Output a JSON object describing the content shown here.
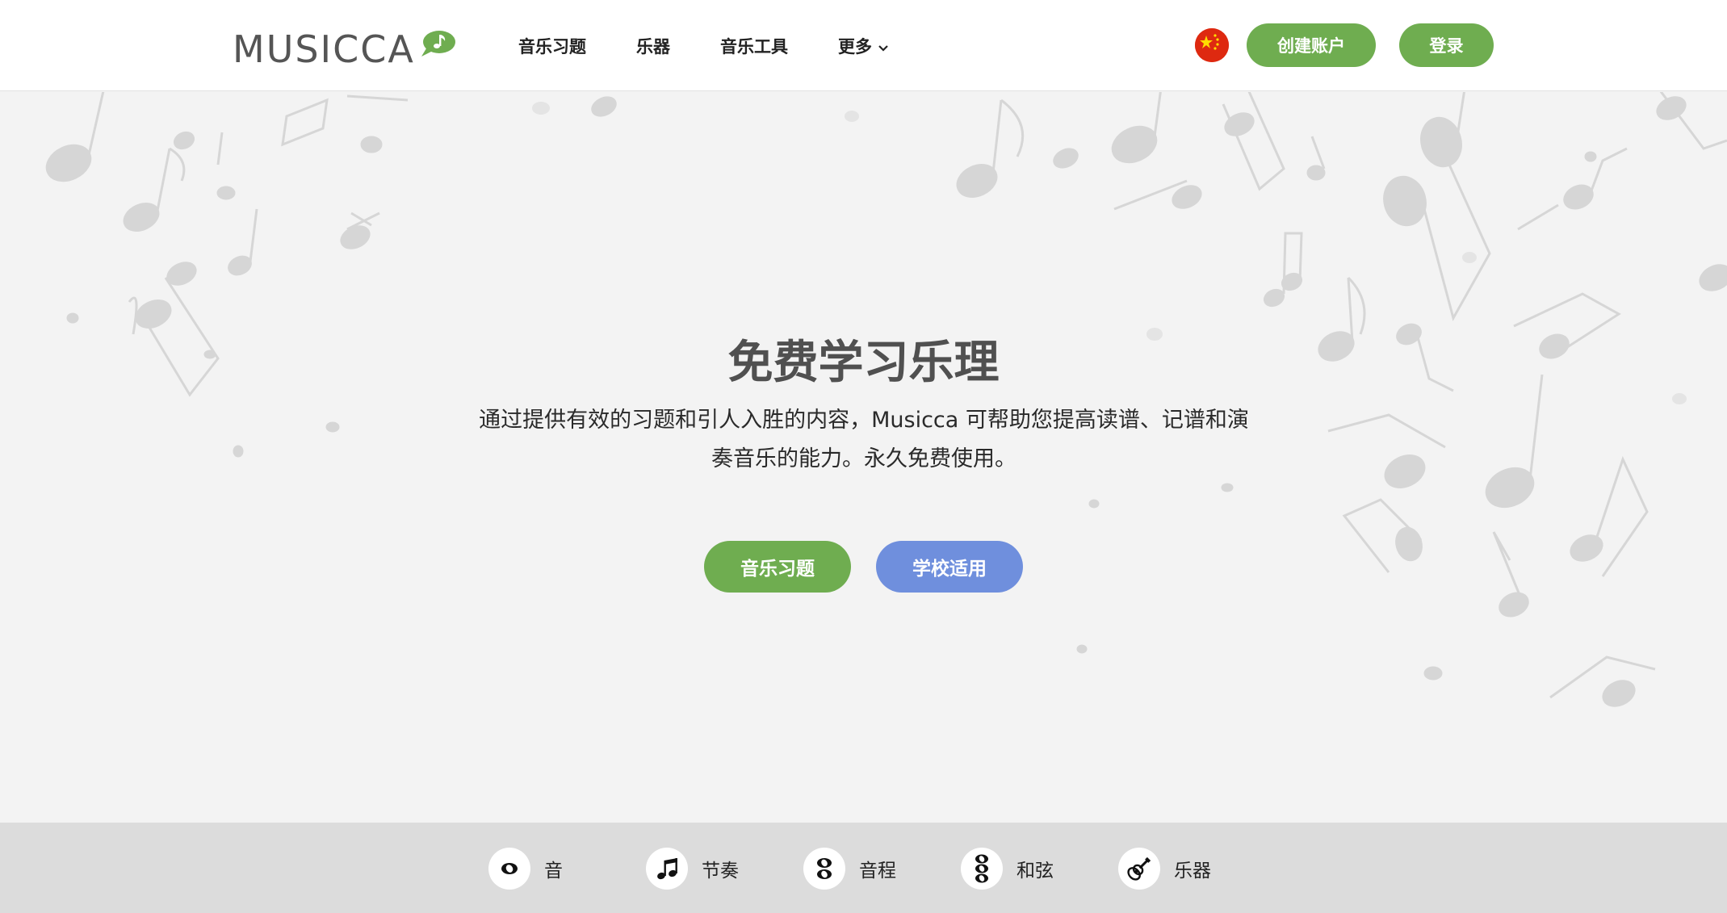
{
  "header": {
    "logo_text": "MUSICCA",
    "nav": [
      {
        "label": "音乐习题"
      },
      {
        "label": "乐器"
      },
      {
        "label": "音乐工具"
      },
      {
        "label": "更多"
      }
    ],
    "language_flag": "china-flag-icon",
    "create_account_label": "创建账户",
    "login_label": "登录"
  },
  "hero": {
    "title": "免费学习乐理",
    "description": "通过提供有效的习题和引人入胜的内容，Musicca 可帮助您提高读谱、记谱和演奏音乐的能力。永久免费使用。",
    "primary_button": "音乐习题",
    "secondary_button": "学校适用"
  },
  "categories": [
    {
      "label": "音",
      "icon": "whole-note-icon"
    },
    {
      "label": "节奏",
      "icon": "beamed-notes-icon"
    },
    {
      "label": "音程",
      "icon": "interval-notes-icon"
    },
    {
      "label": "和弦",
      "icon": "chord-notes-icon"
    },
    {
      "label": "乐器",
      "icon": "guitar-icon"
    }
  ],
  "colors": {
    "brand_green": "#6fad50",
    "school_blue": "#6f8fdd",
    "hero_bg": "#f3f3f3",
    "category_bar_bg": "#dcdcdc"
  }
}
